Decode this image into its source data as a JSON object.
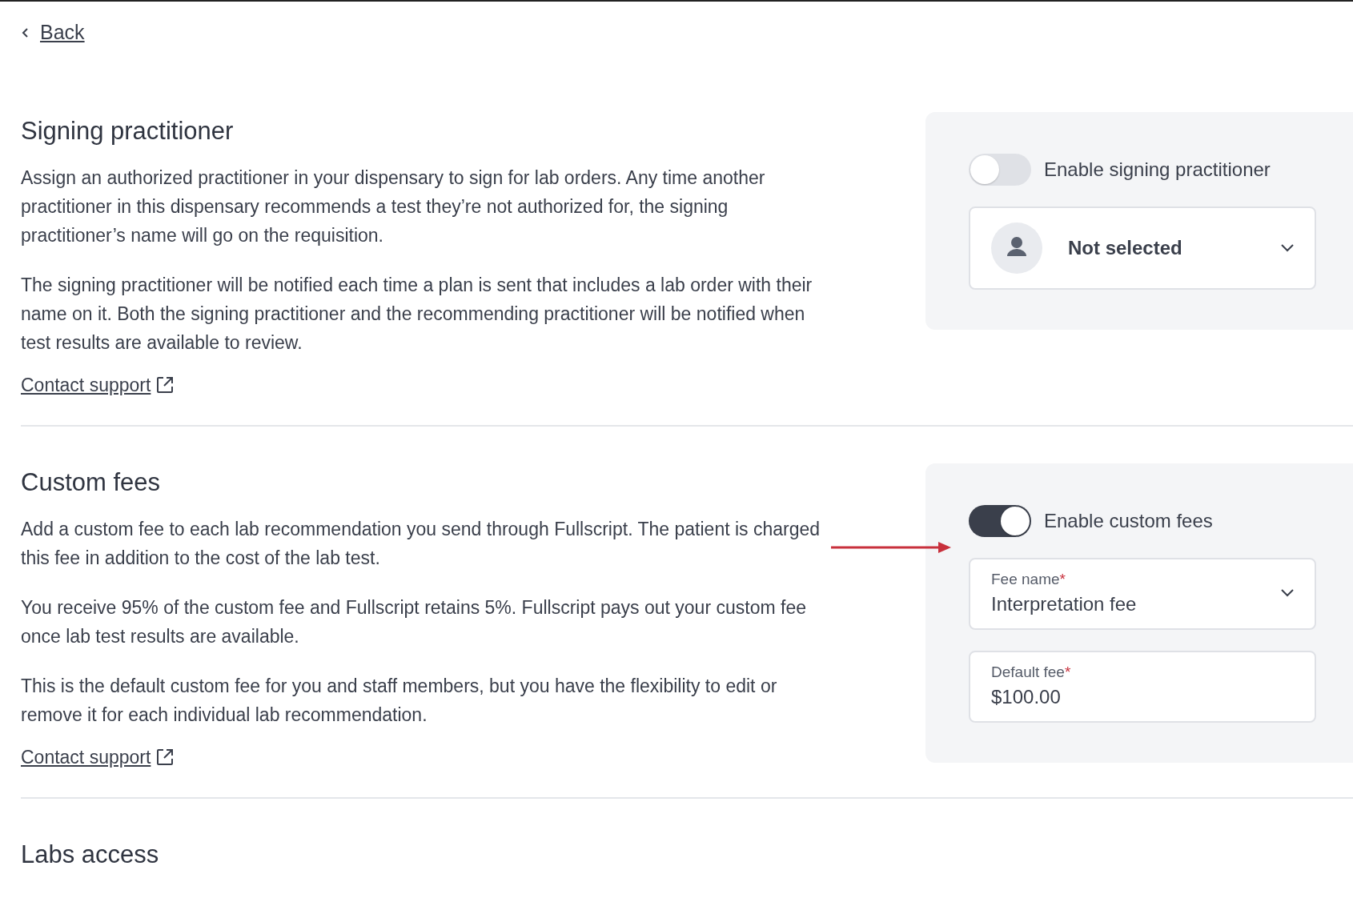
{
  "back_link": "Back",
  "sections": [
    {
      "title": "Signing practitioner",
      "paragraphs": [
        "Assign an authorized practitioner in your dispensary to sign for lab orders. Any time another practitioner in this dispensary recommends a test they’re not authorized for, the signing practitioner’s name will go on the requisition.",
        "The signing practitioner will be notified each time a plan is sent that includes a lab order with their name on it. Both the signing practitioner and the recommending practitioner will be notified when test results are available to review."
      ],
      "link": "Contact support",
      "panel": {
        "toggle": {
          "label": "Enable signing practitioner",
          "on": false,
          "annotated": false
        },
        "fields": [
          {
            "kind": "person-select",
            "value": "Not selected"
          }
        ]
      }
    },
    {
      "title": "Custom fees",
      "paragraphs": [
        "Add a custom fee to each lab recommendation you send through Fullscript. The patient is charged this fee in addition to the cost of the lab test.",
        "You receive 95% of the custom fee and Fullscript retains 5%. Fullscript pays out your custom fee once lab test results are available.",
        "This is the default custom fee for you and staff members, but you have the flexibility to edit or remove it for each individual lab recommendation."
      ],
      "link": "Contact support",
      "panel": {
        "toggle": {
          "label": "Enable custom fees",
          "on": true,
          "annotated": true
        },
        "fields": [
          {
            "kind": "select",
            "label": "Fee name",
            "required_mark": "*",
            "value": "Interpretation fee"
          },
          {
            "kind": "text",
            "label": "Default fee",
            "required_mark": "*",
            "value": "$100.00"
          }
        ]
      }
    },
    {
      "title": "Labs access"
    }
  ]
}
